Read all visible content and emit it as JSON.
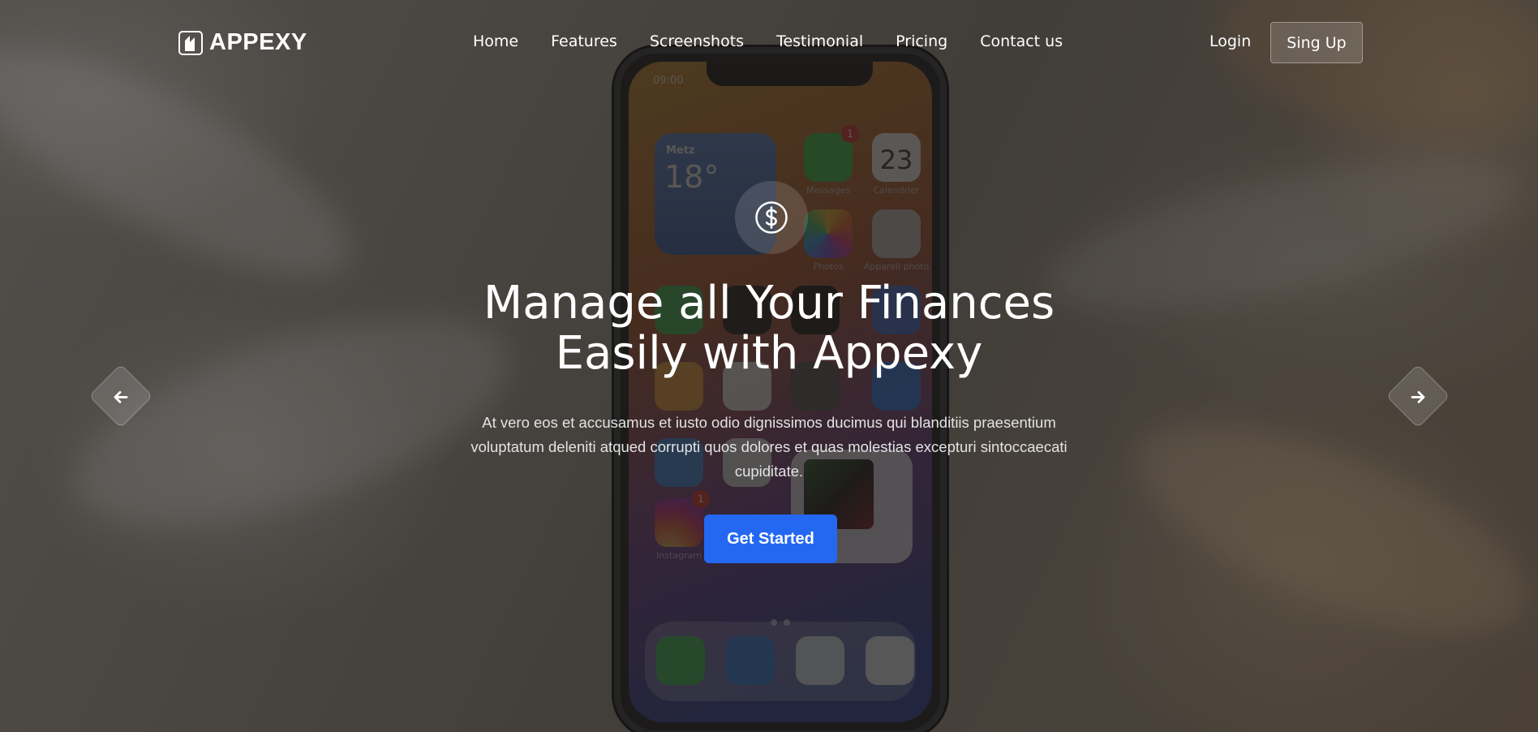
{
  "brand": {
    "name": "APPEXY"
  },
  "nav": {
    "items": [
      "Home",
      "Features",
      "Screenshots",
      "Testimonial",
      "Pricing",
      "Contact us"
    ]
  },
  "auth": {
    "login_label": "Login",
    "signup_label": "Sing Up"
  },
  "hero": {
    "icon": "dollar-icon",
    "title_line1": "Manage all Your Finances",
    "title_line2": "Easily with Appexy",
    "description": "At vero eos et accusamus et iusto odio dignissimos ducimus qui blanditiis praesentium voluptatum deleniti atqued corrupti quos dolores et quas molestias excepturi sintoccaecati cupiditate.",
    "cta_label": "Get Started"
  },
  "slider": {
    "prev_icon": "arrow-left-icon",
    "next_icon": "arrow-right-icon"
  },
  "phone_screen": {
    "time": "09:00",
    "weather_city": "Metz",
    "weather_temp": "18°",
    "apps": [
      "Messages",
      "Calendrier",
      "Photos",
      "Appareil photo",
      "Instagram"
    ],
    "calendar_day": "23",
    "badge_count": "1"
  },
  "colors": {
    "accent": "#2468f2"
  }
}
